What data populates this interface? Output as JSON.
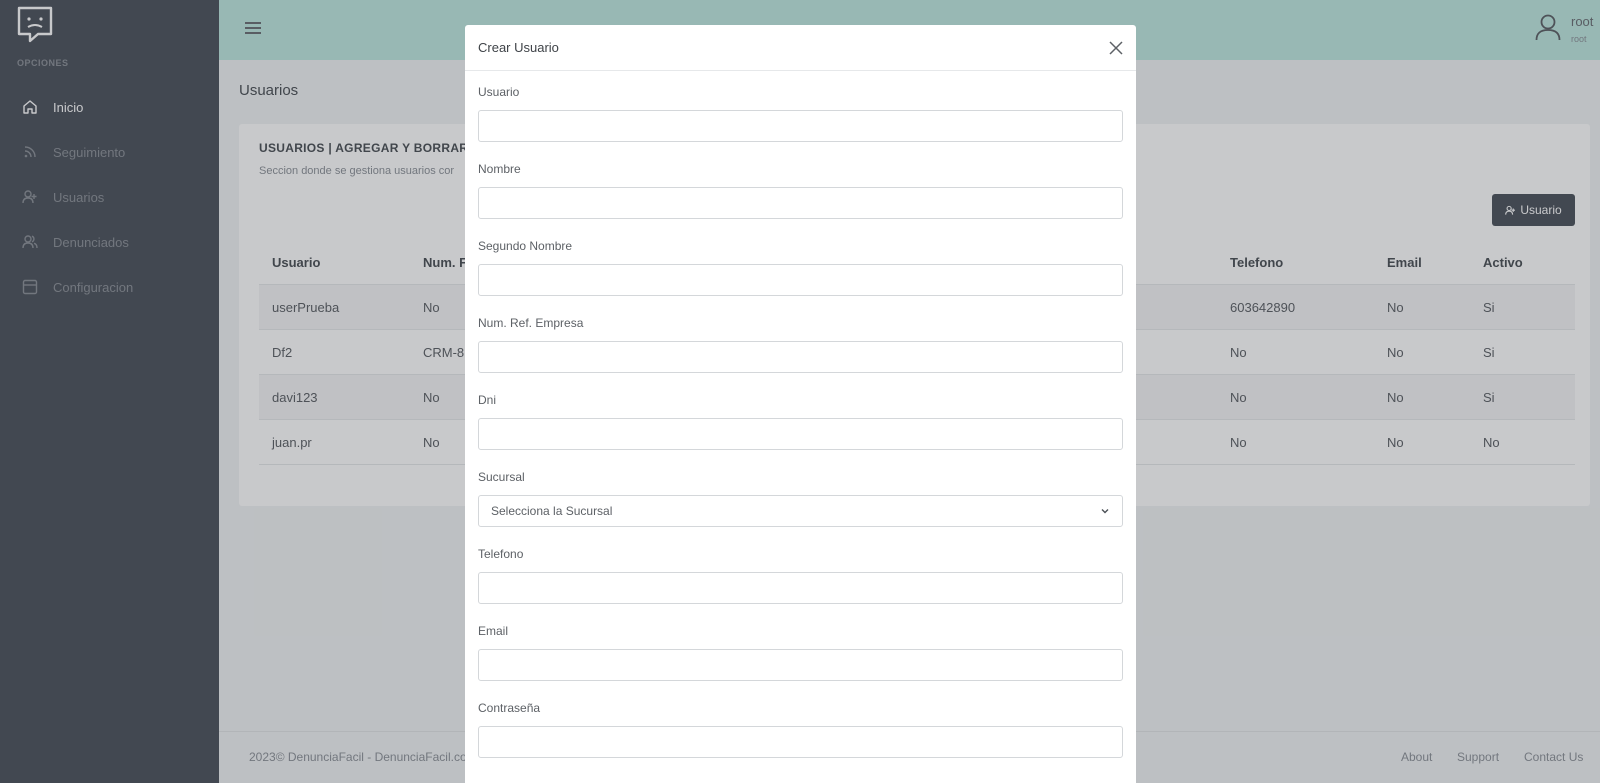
{
  "sidebar": {
    "section_label": "OPCIONES",
    "items": [
      {
        "label": "Inicio",
        "icon": "home-icon",
        "active": true
      },
      {
        "label": "Seguimiento",
        "icon": "rss-icon",
        "active": false
      },
      {
        "label": "Usuarios",
        "icon": "user-add-icon",
        "active": false
      },
      {
        "label": "Denunciados",
        "icon": "users-icon",
        "active": false
      },
      {
        "label": "Configuracion",
        "icon": "layout-icon",
        "active": false
      }
    ]
  },
  "header": {
    "user_name": "root",
    "user_role": "root",
    "colors": {
      "bar": "#7dd3c3"
    }
  },
  "page": {
    "title": "Usuarios",
    "card_title": "USUARIOS | AGREGAR Y BORRAR",
    "card_subtitle": "Seccion donde se gestiona usuarios cor",
    "add_button": "Usuario"
  },
  "table": {
    "headers": {
      "usuario": "Usuario",
      "numref": "Num. F",
      "telefono": "Telefono",
      "email": "Email",
      "activo": "Activo"
    },
    "rows": [
      {
        "usuario": "userPrueba",
        "numref": "No",
        "telefono": "603642890",
        "email": "No",
        "activo": "Si"
      },
      {
        "usuario": "Df2",
        "numref": "CRM-8",
        "telefono": "No",
        "email": "No",
        "activo": "Si"
      },
      {
        "usuario": "davi123",
        "numref": "No",
        "telefono": "No",
        "email": "No",
        "activo": "Si"
      },
      {
        "usuario": "juan.pr",
        "numref": "No",
        "telefono": "No",
        "email": "No",
        "activo": "No"
      }
    ]
  },
  "footer": {
    "copyright": "2023© DenunciaFacil - DenunciaFacil.co",
    "links": [
      "About",
      "Support",
      "Contact Us"
    ]
  },
  "modal": {
    "title": "Crear Usuario",
    "fields": {
      "usuario": {
        "label": "Usuario",
        "value": ""
      },
      "nombre": {
        "label": "Nombre",
        "value": ""
      },
      "segundo_nombre": {
        "label": "Segundo Nombre",
        "value": ""
      },
      "num_ref": {
        "label": "Num. Ref. Empresa",
        "value": ""
      },
      "dni": {
        "label": "Dni",
        "value": ""
      },
      "sucursal": {
        "label": "Sucursal",
        "selected": "Selecciona la Sucursal"
      },
      "telefono": {
        "label": "Telefono",
        "value": ""
      },
      "email": {
        "label": "Email",
        "value": ""
      },
      "contrasena": {
        "label": "Contraseña",
        "value": ""
      }
    }
  },
  "colors": {
    "sidebar": "#4d535d",
    "header": "#7dd3c3",
    "button": "#4d535d"
  }
}
